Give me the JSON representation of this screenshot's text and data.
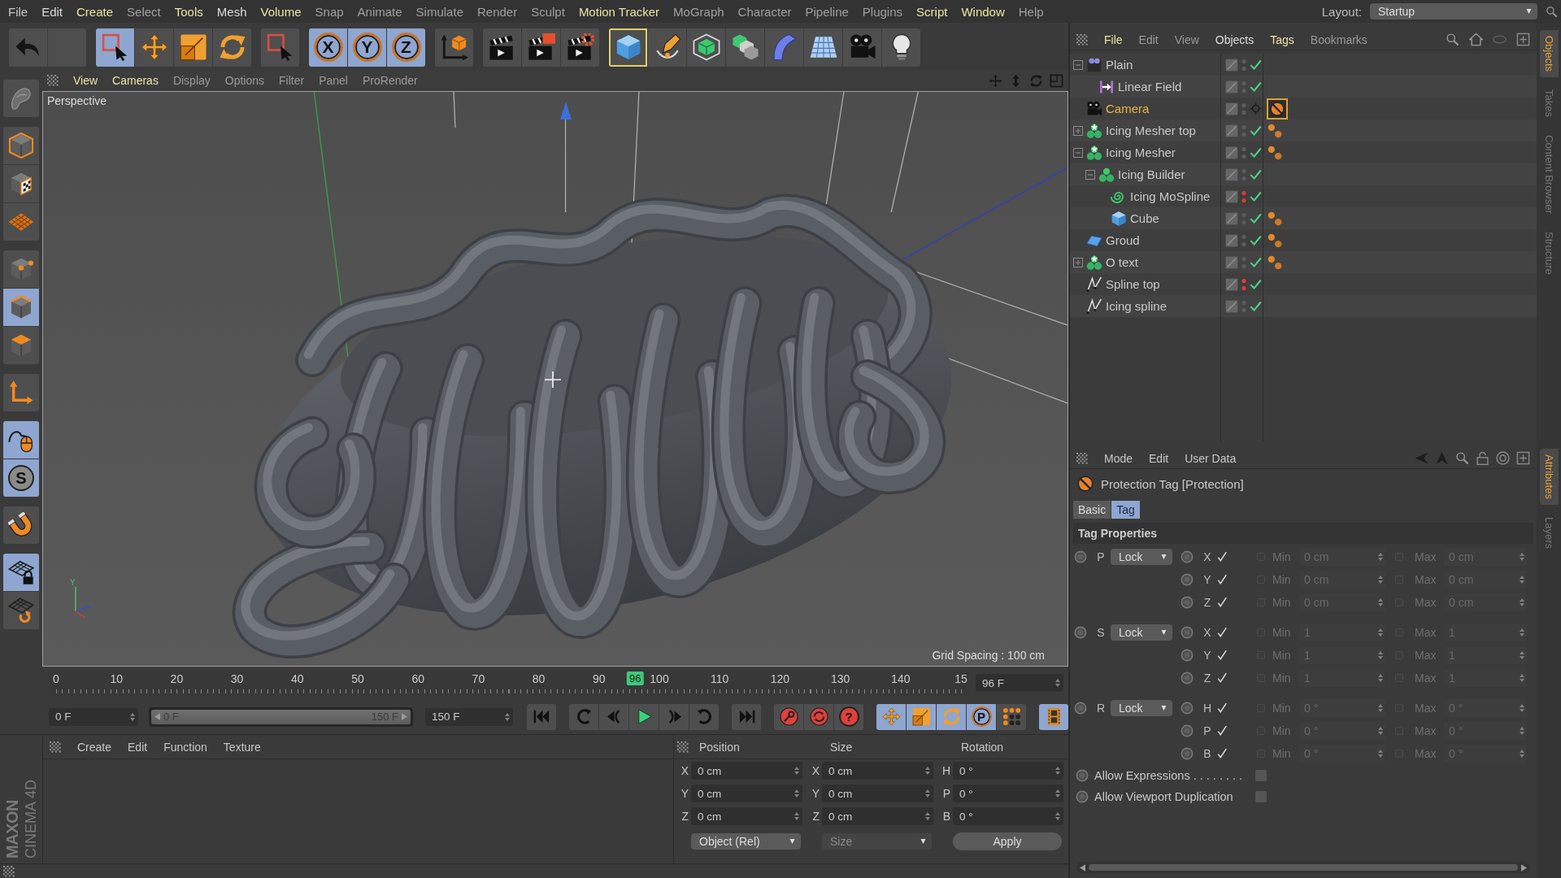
{
  "menu_bar": {
    "items": [
      {
        "label": "File",
        "color": "#c4c4c4"
      },
      {
        "label": "Edit",
        "color": "#dcdcdc"
      },
      {
        "label": "Create",
        "color": "#e8e4a4"
      },
      {
        "label": "Select",
        "color": "#a0a0a0"
      },
      {
        "label": "Tools",
        "color": "#e8e4a4"
      },
      {
        "label": "Mesh",
        "color": "#dcdcdc"
      },
      {
        "label": "Volume",
        "color": "#e8e4a4"
      },
      {
        "label": "Snap",
        "color": "#a0a0a0"
      },
      {
        "label": "Animate",
        "color": "#a0a0a0"
      },
      {
        "label": "Simulate",
        "color": "#a0a0a0"
      },
      {
        "label": "Render",
        "color": "#a0a0a0"
      },
      {
        "label": "Sculpt",
        "color": "#a0a0a0"
      },
      {
        "label": "Motion Tracker",
        "color": "#e8e4a4"
      },
      {
        "label": "MoGraph",
        "color": "#a0a0a0"
      },
      {
        "label": "Character",
        "color": "#a0a0a0"
      },
      {
        "label": "Pipeline",
        "color": "#a0a0a0"
      },
      {
        "label": "Plugins",
        "color": "#a0a0a0"
      },
      {
        "label": "Script",
        "color": "#e8e4a4"
      },
      {
        "label": "Window",
        "color": "#e8e4a4"
      },
      {
        "label": "Help",
        "color": "#a0a0a0"
      }
    ],
    "layout_label": "Layout:",
    "layout_value": "Startup"
  },
  "toolbar": {
    "groups": [
      [
        {
          "selected": false
        },
        {
          "selected": false
        }
      ],
      [
        {
          "selected": true
        },
        {
          "selected": false
        },
        {
          "selected": false
        },
        {
          "selected": false
        }
      ],
      [
        {
          "selected": false
        }
      ],
      [
        {
          "label": "X",
          "selected": true
        },
        {
          "label": "Y",
          "selected": true
        },
        {
          "label": "Z",
          "selected": true
        }
      ],
      [
        {
          "selected": false
        }
      ],
      [
        {
          "selected": false
        },
        {
          "selected": false
        },
        {
          "selected": false
        }
      ],
      [
        {
          "selected": false,
          "focused": true
        },
        {
          "selected": false,
          "focused": false
        },
        {
          "selected": false,
          "focused": false
        },
        {
          "selected": false,
          "focused": false
        },
        {
          "selected": false,
          "focused": false
        },
        {
          "selected": false,
          "focused": false
        },
        {
          "selected": false,
          "focused": false
        },
        {
          "selected": false,
          "focused": false
        }
      ]
    ]
  },
  "tools": {
    "groups": [
      [
        {
          "selected": false
        }
      ],
      [
        {
          "selected": false
        },
        {
          "selected": false
        },
        {
          "selected": false
        }
      ],
      [
        {
          "selected": false
        },
        {
          "selected": true
        },
        {
          "selected": false
        }
      ],
      [
        {
          "selected": false
        }
      ],
      [
        {
          "selected": true
        },
        {
          "label": "S",
          "selected": true
        }
      ],
      [
        {
          "selected": false
        }
      ],
      [
        {
          "selected": true
        },
        {
          "selected": false
        }
      ]
    ]
  },
  "viewport": {
    "menu": [
      {
        "label": "View",
        "color": "#e8e4a4"
      },
      {
        "label": "Cameras",
        "color": "#e8e4a4"
      },
      {
        "label": "Display",
        "color": "#9a9a9a"
      },
      {
        "label": "Options",
        "color": "#9a9a9a"
      },
      {
        "label": "Filter",
        "color": "#9a9a9a"
      },
      {
        "label": "Panel",
        "color": "#9a9a9a"
      },
      {
        "label": "ProRender",
        "color": "#9a9a9a"
      }
    ],
    "camera": "Perspective",
    "grid_spacing": "Grid Spacing : 100 cm",
    "axis_label": "Y"
  },
  "timeline": {
    "ticks": [
      "0",
      "10",
      "20",
      "30",
      "40",
      "50",
      "60",
      "70",
      "80",
      "90",
      "100",
      "110",
      "120",
      "130",
      "140",
      "15"
    ],
    "playhead": {
      "label": "96",
      "level": 0.64
    },
    "current_frame": "96 F",
    "start_field": "0 F",
    "range": {
      "start": "0 F",
      "end": "150 F",
      "level": 1
    },
    "end_field": "150 F",
    "groups": [
      [
        {
          "selected": false
        }
      ],
      [
        {
          "selected": false
        },
        {
          "selected": false
        },
        {
          "selected": false
        },
        {
          "selected": false
        },
        {
          "selected": false
        }
      ],
      [
        {
          "selected": false
        }
      ],
      [
        {
          "selected": false
        },
        {
          "selected": false
        },
        {
          "label": "?",
          "selected": false
        }
      ],
      [
        {
          "selected": true
        },
        {
          "selected": true
        },
        {
          "selected": true
        },
        {
          "label": "P",
          "selected": true
        },
        {
          "selected": false
        }
      ],
      [
        {
          "selected": true
        }
      ]
    ]
  },
  "logo": {
    "brand": "MAXON",
    "product": "CINEMA 4D"
  },
  "materials": {
    "menu": [
      "Create",
      "Edit",
      "Function",
      "Texture"
    ]
  },
  "coordinates": {
    "headers": [
      "Position",
      "Size",
      "Rotation"
    ],
    "rows": [
      [
        {
          "axis": "X",
          "value": "0 cm"
        },
        {
          "axis": "X",
          "value": "0 cm"
        },
        {
          "axis": "H",
          "value": "0 °"
        }
      ],
      [
        {
          "axis": "Y",
          "value": "0 cm"
        },
        {
          "axis": "Y",
          "value": "0 cm"
        },
        {
          "axis": "P",
          "value": "0 °"
        }
      ],
      [
        {
          "axis": "Z",
          "value": "0 cm"
        },
        {
          "axis": "Z",
          "value": "0 cm"
        },
        {
          "axis": "B",
          "value": "0 °"
        }
      ]
    ],
    "mode": "Object (Rel)",
    "size_mode": {
      "label": "Size",
      "disabled": true
    },
    "apply": "Apply"
  },
  "objects": {
    "menu": [
      {
        "label": "File",
        "color": "#e8e4a4"
      },
      {
        "label": "Edit",
        "color": "#9a9a9a"
      },
      {
        "label": "View",
        "color": "#9a9a9a"
      },
      {
        "label": "Objects",
        "color": "#dcdcdc"
      },
      {
        "label": "Tags",
        "color": "#e8e4a4"
      },
      {
        "label": "Bookmarks",
        "color": "#9a9a9a"
      }
    ],
    "items": [
      {
        "name": "Plain",
        "kind": "null",
        "selected": false,
        "hidden": false,
        "expanded": true,
        "children": [
          {
            "name": "Linear Field",
            "kind": "field",
            "selected": false,
            "hidden": false
          }
        ]
      },
      {
        "name": "Camera",
        "kind": "camera",
        "selected": true,
        "hidden": false,
        "tags": [
          {
            "kind": "protection",
            "selected": true
          }
        ]
      },
      {
        "name": "Icing Mesher top",
        "kind": "mesher",
        "selected": false,
        "hidden": false,
        "expanded": false,
        "tags": [
          {
            "kind": "phong",
            "selected": false
          }
        ]
      },
      {
        "name": "Icing Mesher",
        "kind": "mesher",
        "selected": false,
        "hidden": false,
        "expanded": true,
        "tags": [
          {
            "kind": "phong",
            "selected": false
          }
        ],
        "children": [
          {
            "name": "Icing Builder",
            "kind": "cloner",
            "selected": false,
            "hidden": false,
            "expanded": true,
            "children": [
              {
                "name": "Icing MoSpline",
                "kind": "mospline",
                "selected": false,
                "hidden": true
              },
              {
                "name": "Cube",
                "kind": "cube",
                "selected": false,
                "hidden": false,
                "tags": [
                  {
                    "kind": "phong",
                    "selected": false
                  }
                ]
              }
            ]
          }
        ]
      },
      {
        "name": "Groud",
        "kind": "plane",
        "selected": false,
        "hidden": false,
        "tags": [
          {
            "kind": "phong",
            "selected": false
          }
        ]
      },
      {
        "name": "O text",
        "kind": "mesher",
        "selected": false,
        "hidden": false,
        "expanded": false,
        "tags": [
          {
            "kind": "phong",
            "selected": false
          }
        ]
      },
      {
        "name": "Spline top",
        "kind": "spline",
        "selected": false,
        "hidden": true
      },
      {
        "name": "Icing spline",
        "kind": "spline",
        "selected": false,
        "hidden": false
      }
    ],
    "side_tabs": [
      {
        "label": "Objects",
        "selected": true
      },
      {
        "label": "Takes",
        "selected": false
      },
      {
        "label": "Content Browser",
        "selected": false
      },
      {
        "label": "Structure",
        "selected": false
      }
    ]
  },
  "attributes": {
    "menu": [
      "Mode",
      "Edit",
      "User Data"
    ],
    "title": "Protection Tag [Protection]",
    "tabs": [
      {
        "label": "Basic",
        "selected": false
      },
      {
        "label": "Tag",
        "selected": true
      }
    ],
    "section": "Tag Properties",
    "groups": [
      {
        "letter": "P",
        "mode": "Lock",
        "rows": [
          {
            "axis": "X",
            "checked": true,
            "min_on": false,
            "min_label": "Min",
            "min": "0 cm",
            "max_on": false,
            "max_label": "Max",
            "max": "0 cm"
          },
          {
            "axis": "Y",
            "checked": true,
            "min_on": false,
            "min_label": "Min",
            "min": "0 cm",
            "max_on": false,
            "max_label": "Max",
            "max": "0 cm"
          },
          {
            "axis": "Z",
            "checked": true,
            "min_on": false,
            "min_label": "Min",
            "min": "0 cm",
            "max_on": false,
            "max_label": "Max",
            "max": "0 cm"
          }
        ]
      },
      {
        "letter": "S",
        "mode": "Lock",
        "rows": [
          {
            "axis": "X",
            "checked": true,
            "min_on": false,
            "min_label": "Min",
            "min": "1",
            "max_on": false,
            "max_label": "Max",
            "max": "1"
          },
          {
            "axis": "Y",
            "checked": true,
            "min_on": false,
            "min_label": "Min",
            "min": "1",
            "max_on": false,
            "max_label": "Max",
            "max": "1"
          },
          {
            "axis": "Z",
            "checked": true,
            "min_on": false,
            "min_label": "Min",
            "min": "1",
            "max_on": false,
            "max_label": "Max",
            "max": "1"
          }
        ]
      },
      {
        "letter": "R",
        "mode": "Lock",
        "rows": [
          {
            "axis": "H",
            "checked": true,
            "min_on": false,
            "min_label": "Min",
            "min": "0 °",
            "max_on": false,
            "max_label": "Max",
            "max": "0 °"
          },
          {
            "axis": "P",
            "checked": true,
            "min_on": false,
            "min_label": "Min",
            "min": "0 °",
            "max_on": false,
            "max_label": "Max",
            "max": "0 °"
          },
          {
            "axis": "B",
            "checked": true,
            "min_on": false,
            "min_label": "Min",
            "min": "0 °",
            "max_on": false,
            "max_label": "Max",
            "max": "0 °"
          }
        ]
      }
    ],
    "options": [
      {
        "label": "Allow Expressions . . . . . . . .",
        "checked": false
      },
      {
        "label": "Allow Viewport Duplication",
        "checked": false
      }
    ],
    "side_tabs": [
      {
        "label": "Attributes",
        "selected": true
      },
      {
        "label": "Layers",
        "selected": false
      }
    ]
  }
}
